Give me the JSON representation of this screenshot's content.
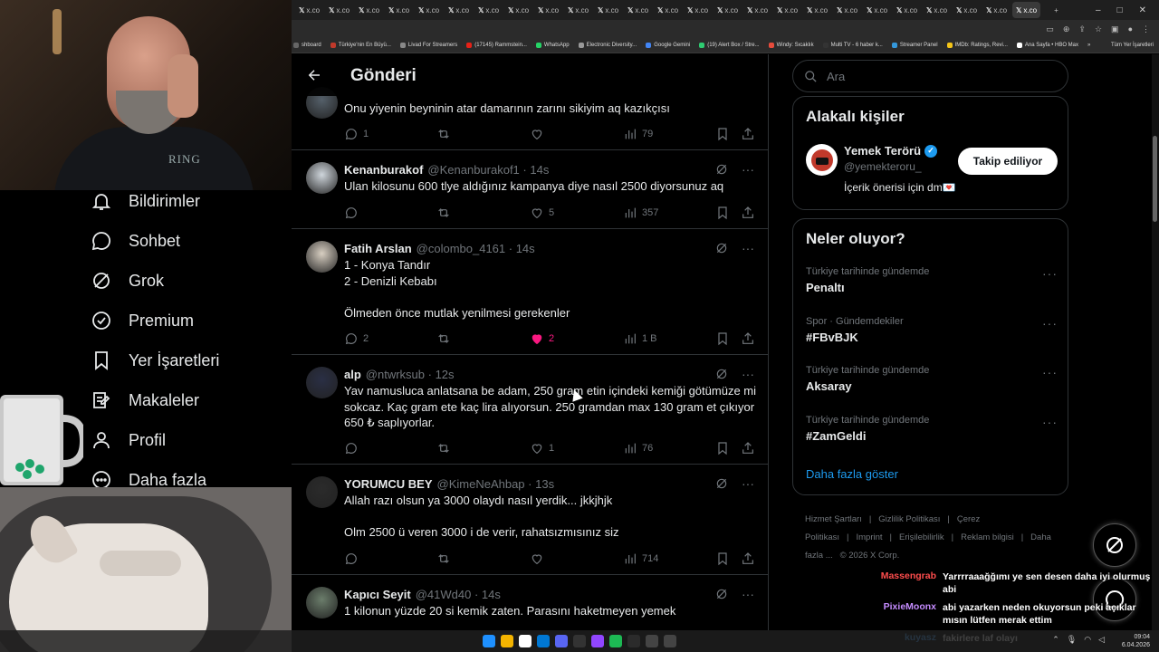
{
  "browser": {
    "tab_count": 25,
    "tab_label": "x.co",
    "new_tab": "+",
    "window_controls": [
      "–",
      "□",
      "✕"
    ]
  },
  "bookmarks": [
    {
      "label": "shboard",
      "color": "#666666"
    },
    {
      "label": "Türkiye'nin En Büyü...",
      "color": "#c0392b"
    },
    {
      "label": "Livad For Streamers",
      "color": "#888888"
    },
    {
      "label": "(17145) Rammstein...",
      "color": "#e62117"
    },
    {
      "label": "WhatsApp",
      "color": "#25d366"
    },
    {
      "label": "Electronic Diversity...",
      "color": "#999999"
    },
    {
      "label": "Google Gemini",
      "color": "#4285f4"
    },
    {
      "label": "(19) Alert Box / Stre...",
      "color": "#2ecc71"
    },
    {
      "label": "Windy: Sıcaklık",
      "color": "#e74c3c"
    },
    {
      "label": "Multi TV - 6 haber k...",
      "color": "#333333"
    },
    {
      "label": "Streamer Panel",
      "color": "#3498db"
    },
    {
      "label": "IMDb: Ratings, Revi...",
      "color": "#f5c518"
    },
    {
      "label": "Ana Sayfa • HBO Max",
      "color": "#ffffff"
    }
  ],
  "bookmarks_overflow": "»",
  "bookmarks_all": "Tüm Yer İşaretleri",
  "left_nav": {
    "items": [
      {
        "label": "Bildirimler",
        "icon": "bell-icon"
      },
      {
        "label": "Sohbet",
        "icon": "chat-icon"
      },
      {
        "label": "Grok",
        "icon": "grok-icon"
      },
      {
        "label": "Premium",
        "icon": "premium-icon"
      },
      {
        "label": "Yer İşaretleri",
        "icon": "bookmark-icon"
      },
      {
        "label": "Makaleler",
        "icon": "article-icon"
      },
      {
        "label": "Profil",
        "icon": "profile-icon"
      },
      {
        "label": "Daha fazla",
        "icon": "more-icon"
      }
    ]
  },
  "webcam_shirt_text": "RING",
  "main": {
    "title": "Gönderi",
    "tweets": [
      {
        "name": "",
        "handle": "",
        "time": "",
        "text": "Onu yiyenin beyninin atar damarının zarını sikiyim aq kazıkçısı",
        "replies": "1",
        "reposts": "",
        "likes": "",
        "views": "79",
        "liked": false
      },
      {
        "name": "Kenanburakof",
        "handle": "@Kenanburakof1",
        "time": "14s",
        "text": "Ulan kilosunu 600 tlye aldığınız kampanya diye nasıl 2500 diyorsunuz aq",
        "replies": "",
        "reposts": "",
        "likes": "5",
        "views": "357",
        "liked": false
      },
      {
        "name": "Fatih Arslan",
        "handle": "@colombo_4161",
        "time": "14s",
        "text": "1 - Konya Tandır\n2 - Denizli Kebabı\n\nÖlmeden önce mutlak yenilmesi gerekenler",
        "replies": "2",
        "reposts": "",
        "likes": "2",
        "views": "1 B",
        "liked": true
      },
      {
        "name": "alp",
        "handle": "@ntwrksub",
        "time": "12s",
        "text": "Yav namusluca anlatsana be adam, 250 gram etin içindeki kemiği götümüze mi sokcaz. Kaç gram ete kaç lira alıyorsun. 250 gramdan max 130 gram et çıkıyor 650 ₺ saplıyorlar.",
        "replies": "",
        "reposts": "",
        "likes": "1",
        "views": "76",
        "liked": false
      },
      {
        "name": "YORUMCU BEY",
        "handle": "@KimeNeAhbap",
        "time": "13s",
        "text": "Allah razı olsun ya 3000 olaydı nasıl yerdik... jkkjhjk\n\nOlm 2500 ü veren 3000 i de verir, rahatsızmısınız siz",
        "replies": "",
        "reposts": "",
        "likes": "",
        "views": "714",
        "liked": false
      },
      {
        "name": "Kapıcı Seyit",
        "handle": "@41Wd40",
        "time": "14s",
        "text": "1 kilonun yüzde 20 si kemik zaten. Parasını haketmeyen yemek",
        "replies": "",
        "reposts": "",
        "likes": "",
        "views": "",
        "liked": false
      }
    ]
  },
  "sidebar": {
    "search_placeholder": "Ara",
    "related_title": "Alakalı kişiler",
    "suggestion": {
      "name": "Yemek Terörü",
      "handle": "@yemekteroru_",
      "description": "İçerik önerisi için dm💌",
      "button": "Takip ediliyor"
    },
    "trends_title": "Neler oluyor?",
    "trends": [
      {
        "meta": "Türkiye tarihinde gündemde",
        "name": "Penaltı"
      },
      {
        "meta": "Spor · Gündemdekiler",
        "name": "#FBvBJK"
      },
      {
        "meta": "Türkiye tarihinde gündemde",
        "name": "Aksaray"
      },
      {
        "meta": "Türkiye tarihinde gündemde",
        "name": "#ZamGeldi"
      }
    ],
    "show_more": "Daha fazla göster",
    "footer": [
      "Hizmet Şartları",
      "|",
      "Gizlilik Politikası",
      "|",
      "Çerez Politikası",
      "|",
      "Imprint",
      "|",
      "Erişilebilirlik",
      "|",
      "Reklam bilgisi",
      "|",
      "Daha fazla ...",
      "© 2026 X Corp."
    ]
  },
  "chat": [
    {
      "user": "Massengrab",
      "color": "#ff4d4d",
      "msg": "Yarrrraaağğımı ye sen desen daha iyi olurmuş abi"
    },
    {
      "user": "PixieMoonx",
      "color": "#c58cff",
      "msg": "abi yazarken neden okuyorsun peki açıklar mısın lütfen merak ettim"
    },
    {
      "user": "kuyasz",
      "color": "#4da6ff",
      "msg": "fakirlere laf olayı"
    }
  ],
  "taskbar": {
    "time": "09:04",
    "date": "6.04.2026",
    "icons": [
      "#1e90ff",
      "#f4b400",
      "#ffffff",
      "#0078d4",
      "#5865f2",
      "#333333",
      "#9146ff",
      "#1db954",
      "#2b2b2b",
      "#444444",
      "#444444"
    ]
  }
}
